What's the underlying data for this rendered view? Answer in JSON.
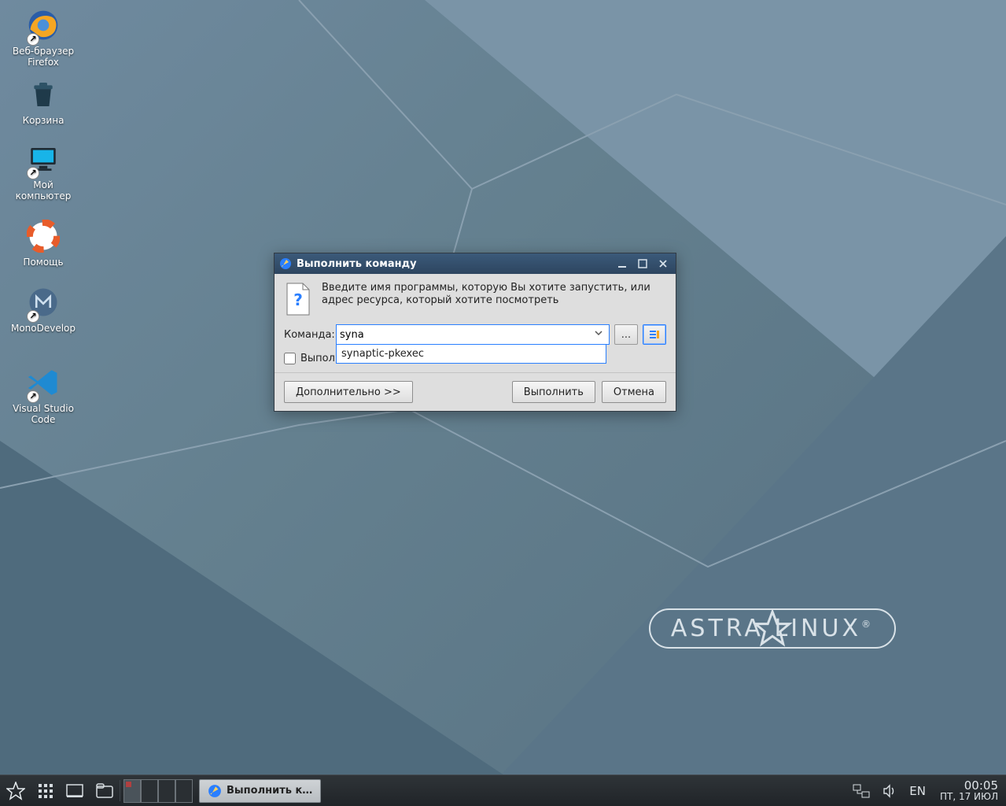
{
  "desktop_icons": [
    {
      "id": "firefox",
      "label": "Веб-браузер\nFirefox",
      "badge": true
    },
    {
      "id": "trash",
      "label": "Корзина",
      "badge": false
    },
    {
      "id": "mycomputer",
      "label": "Мой\nкомпьютер",
      "badge": true
    },
    {
      "id": "help",
      "label": "Помощь",
      "badge": false
    },
    {
      "id": "monodevelop",
      "label": "MonoDevelop",
      "badge": true
    },
    {
      "id": "vscode",
      "label": "Visual Studio\nCode",
      "badge": true
    }
  ],
  "brand": "ASTRA LINUX",
  "dialog": {
    "title": "Выполнить команду",
    "info": "Введите имя программы, которую Вы хотите запустить, или адрес ресурса, который хотите посмотреть",
    "field_label": "Команда:",
    "value": "syna",
    "suggestion": "synaptic-pkexec",
    "browse_tooltip": "...",
    "checkbox_label": "Выпол",
    "advanced": "Дополнительно >>",
    "run": "Выполнить",
    "cancel": "Отмена"
  },
  "taskbar": {
    "task_title": "Выполнить к…",
    "lang": "EN",
    "time": "00:05",
    "date": "ПТ, 17 ИЮЛ"
  }
}
